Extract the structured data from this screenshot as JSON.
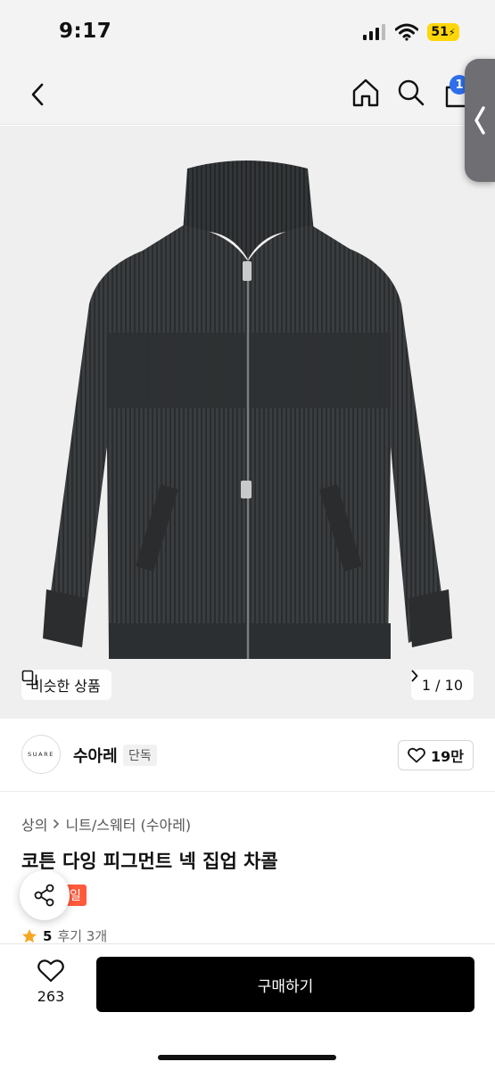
{
  "status_bar": {
    "time": "9:17",
    "battery_level": "51",
    "battery_color": "#ffd60a",
    "icons": [
      "cellular-signal-icon",
      "wifi-icon",
      "battery-icon"
    ]
  },
  "nav": {
    "icons": [
      "chevron-left-icon",
      "home-icon",
      "search-icon",
      "shopping-bag-icon"
    ],
    "cart_badge": "1",
    "badge_color": "#2f6fed"
  },
  "image": {
    "similar_label": "비슷한 상품",
    "counter": "1 / 10"
  },
  "brand": {
    "logo_text": "SUARE",
    "name": "수아레",
    "badge": "단독",
    "likes": "19만"
  },
  "product": {
    "breadcrumb": [
      "상의",
      "니트/스웨터 (수아레)"
    ],
    "title": "코튼 다잉 피그먼트 넥 집업 차콜",
    "promo_badge": "일",
    "promo_color": "#ff5a3c",
    "rating": "5",
    "reviews": "후기 3개",
    "star_color": "#f6a623"
  },
  "bottom": {
    "wish_count": "263",
    "buy_label": "구매하기"
  }
}
